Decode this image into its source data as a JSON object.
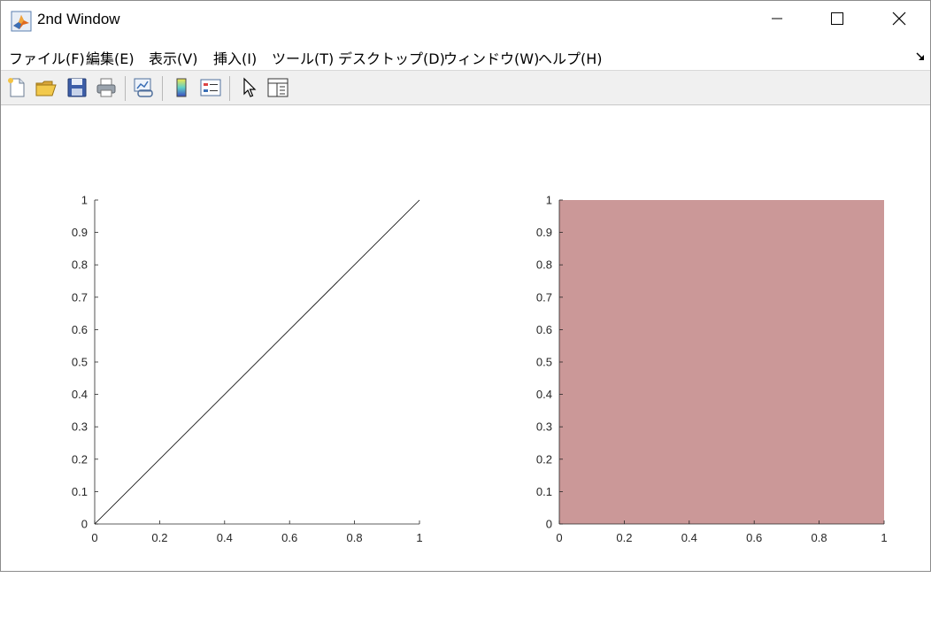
{
  "window": {
    "title": "2nd Window",
    "app_icon": "matlab-membrane-icon",
    "controls": {
      "minimize_icon": "minimize-icon",
      "maximize_icon": "maximize-icon",
      "close_icon": "close-icon"
    }
  },
  "menubar": {
    "items": [
      {
        "label": "ファイル(F)"
      },
      {
        "label": "編集(E)"
      },
      {
        "label": "表示(V)"
      },
      {
        "label": "挿入(I)"
      },
      {
        "label": "ツール(T)"
      },
      {
        "label": "デスクトップ(D)"
      },
      {
        "label": "ウィンドウ(W)"
      },
      {
        "label": "ヘルプ(H)"
      }
    ],
    "dock_icon": "dock-arrow-icon"
  },
  "toolbar": {
    "buttons": [
      {
        "icon": "new-figure-icon"
      },
      {
        "icon": "open-file-icon"
      },
      {
        "icon": "save-icon"
      },
      {
        "icon": "print-icon"
      },
      {
        "icon": "link-plot-icon"
      },
      {
        "icon": "insert-colorbar-icon"
      },
      {
        "icon": "insert-legend-icon"
      },
      {
        "icon": "edit-plot-pointer-icon"
      },
      {
        "icon": "property-inspector-icon"
      }
    ]
  },
  "chart_data": [
    {
      "type": "line",
      "series": [
        {
          "x": [
            0,
            1
          ],
          "y": [
            0,
            1
          ],
          "color": "#000000"
        }
      ],
      "xlim": [
        0,
        1
      ],
      "ylim": [
        0,
        1
      ],
      "xticks": [
        "0",
        "0.2",
        "0.4",
        "0.6",
        "0.8",
        "1"
      ],
      "yticks": [
        "0",
        "0.1",
        "0.2",
        "0.3",
        "0.4",
        "0.5",
        "0.6",
        "0.7",
        "0.8",
        "0.9",
        "1"
      ],
      "grid": false,
      "axes_color": "#262626"
    },
    {
      "type": "area",
      "series": [
        {
          "x": [
            0,
            1
          ],
          "y": [
            1,
            1
          ],
          "color": "#cb9898"
        }
      ],
      "xlim": [
        0,
        1
      ],
      "ylim": [
        0,
        1
      ],
      "xticks": [
        "0",
        "0.2",
        "0.4",
        "0.6",
        "0.8",
        "1"
      ],
      "yticks": [
        "0",
        "0.1",
        "0.2",
        "0.3",
        "0.4",
        "0.5",
        "0.6",
        "0.7",
        "0.8",
        "0.9",
        "1"
      ],
      "grid": false,
      "axes_color": "#262626"
    }
  ]
}
